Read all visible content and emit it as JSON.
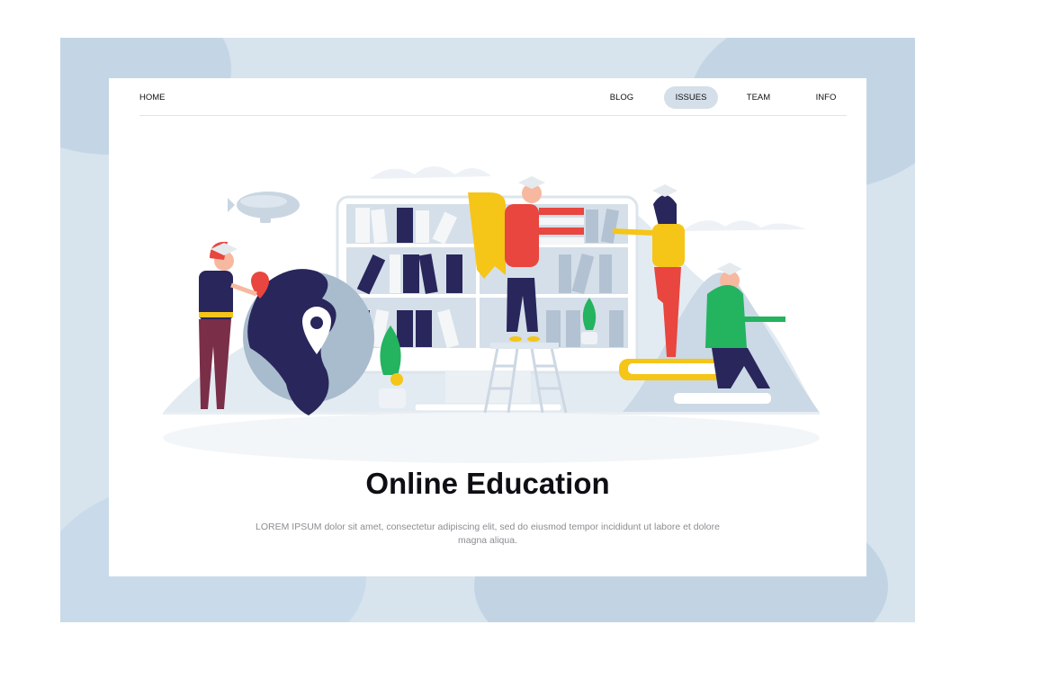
{
  "nav": {
    "home": "HOME",
    "links": [
      "BLOG",
      "ISSUES",
      "TEAM",
      "INFO"
    ],
    "active": "ISSUES"
  },
  "hero": {
    "title": "Online Education",
    "description": "LOREM IPSUM dolor sit amet, consectetur adipiscing elit, sed do eiusmod tempor incididunt ut labore et dolore magna aliqua."
  },
  "colors": {
    "outer_background": "#d7e3ed",
    "card": "#ffffff",
    "active_pill": "#d4dfea",
    "navy": "#29265c",
    "red": "#e8463f",
    "yellow": "#f5c518",
    "green": "#24b35f"
  }
}
